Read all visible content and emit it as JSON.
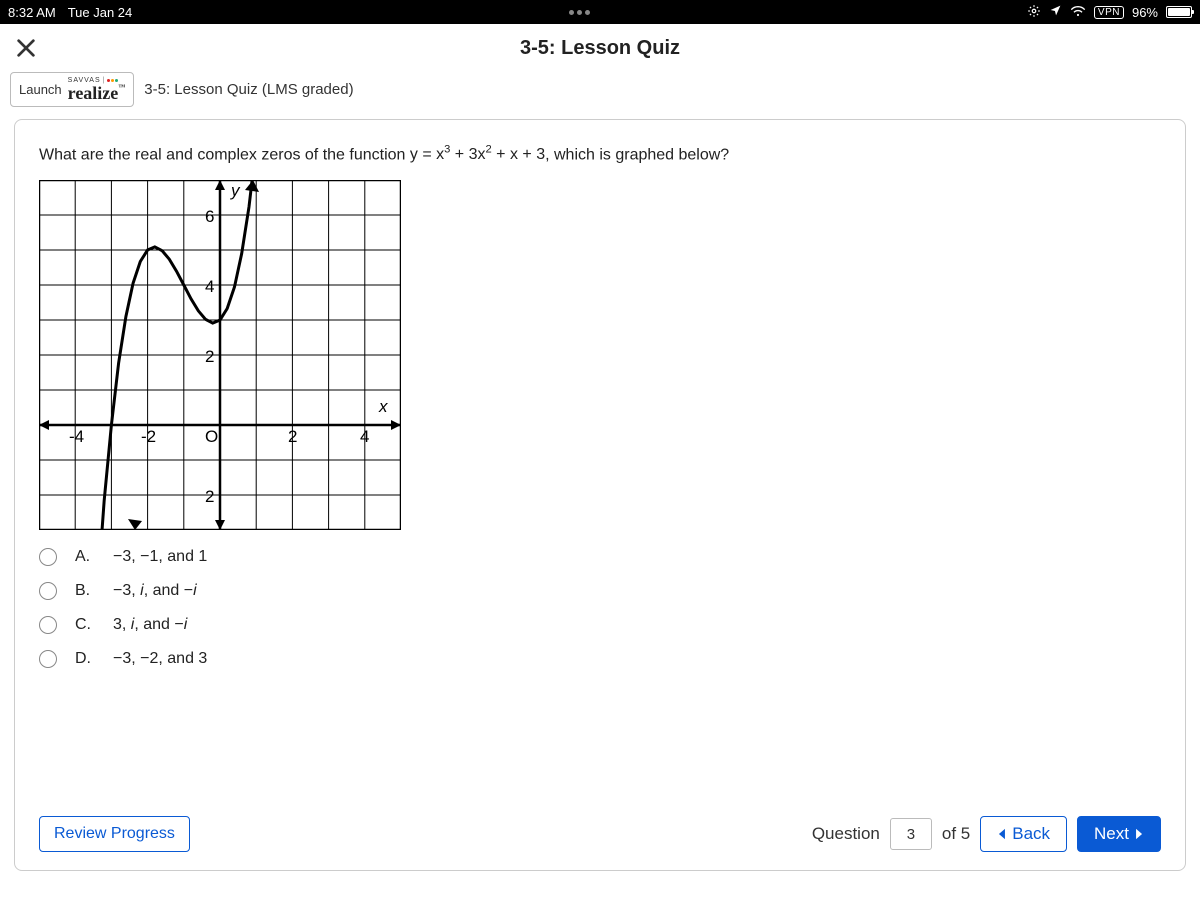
{
  "status": {
    "time": "8:32 AM",
    "date": "Tue Jan 24",
    "vpn": "VPN",
    "battery_pct": "96%"
  },
  "header": {
    "title": "3-5: Lesson Quiz"
  },
  "launch": {
    "prefix": "Launch",
    "brand_top": "SAVVAS",
    "brand_main": "realize",
    "subtitle": "3-5: Lesson Quiz (LMS graded)"
  },
  "question": {
    "prompt_pre": "What are the real and complex zeros of the function ",
    "prompt_fn": "y = x³ + 3x² + x + 3",
    "prompt_post": ", which is graphed below?"
  },
  "graph": {
    "x_ticks": [
      "-4",
      "-2",
      "O",
      "2",
      "4"
    ],
    "y_ticks": [
      "6",
      "4",
      "2",
      "2"
    ],
    "y_label": "y",
    "x_label": "x"
  },
  "options": {
    "a": {
      "letter": "A.",
      "text": "−3, −1, and 1"
    },
    "b": {
      "letter": "B.",
      "text_html": "−3, <i>i</i>, and −<i>i</i>"
    },
    "c": {
      "letter": "C.",
      "text_html": "3, <i>i</i>, and −<i>i</i>"
    },
    "d": {
      "letter": "D.",
      "text": "−3, −2, and 3"
    }
  },
  "footer": {
    "review": "Review Progress",
    "question_label": "Question",
    "current": "3",
    "of": "of 5",
    "back": "Back",
    "next": "Next"
  },
  "chart_data": {
    "type": "line",
    "title": "",
    "xlabel": "x",
    "ylabel": "y",
    "xlim": [
      -5,
      5
    ],
    "ylim": [
      -3,
      7
    ],
    "x_ticks": [
      -4,
      -2,
      0,
      2,
      4
    ],
    "y_ticks": [
      -2,
      2,
      4,
      6
    ],
    "series": [
      {
        "name": "y = x^3 + 3x^2 + x + 3",
        "x": [
          -3.4,
          -3.2,
          -3.0,
          -2.8,
          -2.6,
          -2.4,
          -2.2,
          -2.0,
          -1.8,
          -1.6,
          -1.4,
          -1.2,
          -1.0,
          -0.8,
          -0.6,
          -0.4,
          -0.2,
          0.0,
          0.2,
          0.4,
          0.6,
          0.8,
          1.0
        ],
        "y": [
          -5.02,
          -2.15,
          0.0,
          1.77,
          3.1,
          4.06,
          4.67,
          5.0,
          5.09,
          4.98,
          4.74,
          4.39,
          4.0,
          3.61,
          3.26,
          3.02,
          2.91,
          3.0,
          3.33,
          3.94,
          4.9,
          6.23,
          8.0
        ]
      }
    ]
  }
}
